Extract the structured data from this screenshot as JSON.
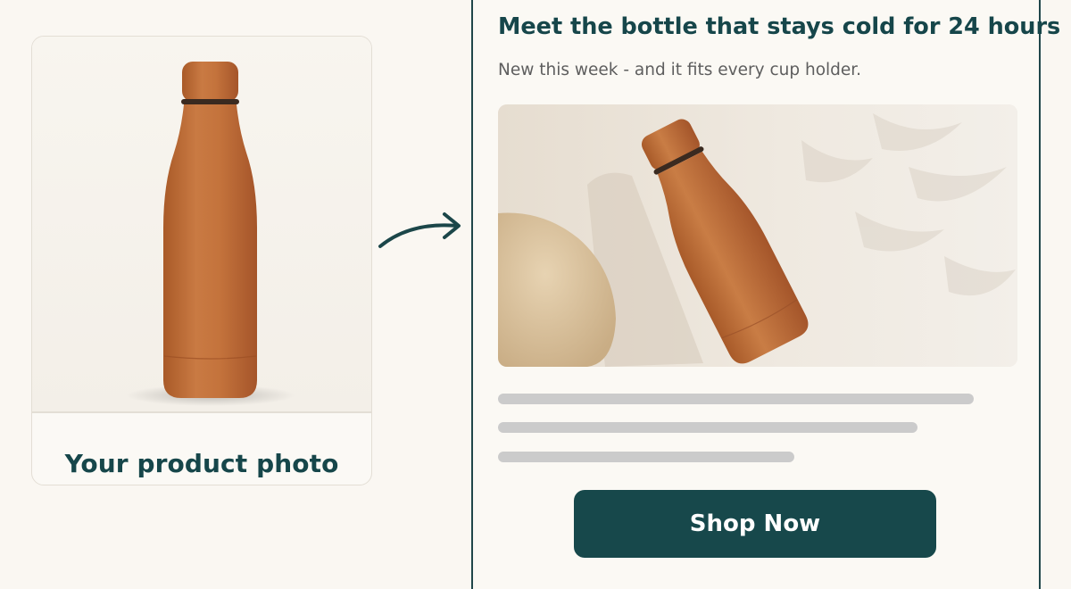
{
  "left_card": {
    "caption": "Your product photo",
    "image_icon": "insulated-bottle-photo"
  },
  "arrow_icon": "curved-arrow-right-icon",
  "email": {
    "headline": "Meet the bottle that stays cold for 24 hours",
    "subtitle": "New this week - and it fits every cup holder.",
    "hero_image_icon": "lifestyle-bottle-photo",
    "placeholder_lines": 3,
    "cta_label": "Shop Now"
  },
  "colors": {
    "background": "#faf7f2",
    "brand_teal": "#17484b",
    "bottle": "#c0703c",
    "placeholder": "#cbcbcb"
  }
}
